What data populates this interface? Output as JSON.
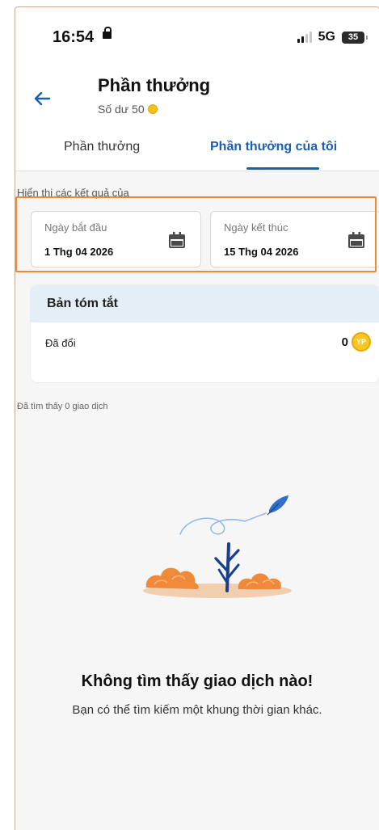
{
  "status": {
    "time": "16:54",
    "network": "5G",
    "battery": "35"
  },
  "header": {
    "title": "Phần thưởng",
    "balance_label": "Số dư 50"
  },
  "tabs": [
    {
      "label": "Phần thưởng",
      "active": false
    },
    {
      "label": "Phần thưởng của tôi",
      "active": true
    }
  ],
  "filter": {
    "showing_label": "Hiển thị các kết quả của",
    "start": {
      "label": "Ngày bắt đầu",
      "value": "1 Thg 04 2026"
    },
    "end": {
      "label": "Ngày kết thúc",
      "value": "15 Thg 04 2026"
    }
  },
  "summary": {
    "title": "Bản tóm tắt",
    "redeemed_label": "Đã đổi",
    "redeemed_value": "0",
    "coin_label": "YP"
  },
  "found_text": "Đã tìm thấy 0 giao dịch",
  "empty": {
    "title": "Không tìm thấy giao dịch nào!",
    "subtitle": "Bạn có thể tìm kiếm một khung thời gian khác."
  },
  "colors": {
    "accent": "#1a5fb4",
    "highlight": "#ef8a34",
    "summary_header_bg": "#e4eef7",
    "coin": "#f6c623"
  }
}
